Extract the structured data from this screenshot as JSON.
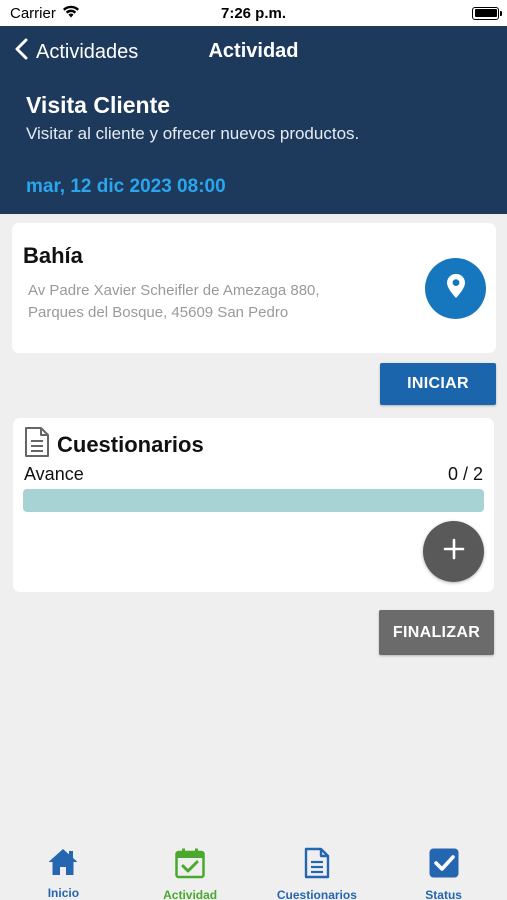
{
  "status_bar": {
    "carrier": "Carrier",
    "time": "7:26 p.m."
  },
  "nav": {
    "back_label": "Actividades",
    "title": "Actividad"
  },
  "activity": {
    "title": "Visita Cliente",
    "description": "Visitar al cliente y ofrecer nuevos productos.",
    "date": "mar, 12 dic 2023 08:00"
  },
  "location": {
    "name": "Bahía",
    "address_line1": "Av Padre Xavier Scheifler de Amezaga 880,",
    "address_line2": "Parques del Bosque, 45609 San Pedro",
    "map_icon": "map-pin-icon"
  },
  "actions": {
    "start_label": "INICIAR",
    "finish_label": "FINALIZAR"
  },
  "questionnaires": {
    "title": "Cuestionarios",
    "progress_label": "Avance",
    "progress_count": "0 / 2",
    "progress_fraction": 0,
    "add_icon": "plus-icon"
  },
  "tabs": [
    {
      "label": "Inicio",
      "icon": "home-icon"
    },
    {
      "label": "Actividad",
      "icon": "calendar-check-icon",
      "active": true
    },
    {
      "label": "Cuestionarios",
      "icon": "document-icon"
    },
    {
      "label": "Status",
      "icon": "checkbox-icon"
    }
  ],
  "colors": {
    "header_bg": "#1d3a5c",
    "date_accent": "#2ba6ee",
    "primary_button": "#1a65ac",
    "finish_button": "#6b6b6b",
    "tab_default": "#2566b0",
    "tab_active": "#4aa92d",
    "progress_track": "#a8d3d4"
  }
}
